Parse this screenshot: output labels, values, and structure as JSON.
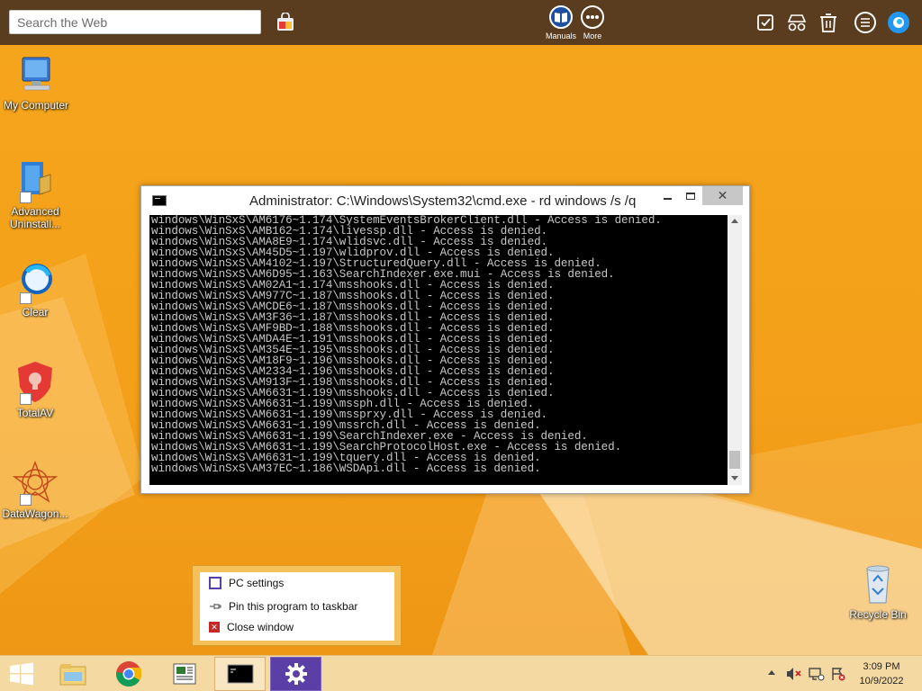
{
  "toolbar": {
    "search_placeholder": "Search the Web",
    "manuals_label": "Manuals",
    "more_label": "More"
  },
  "desktop_icons": [
    {
      "label": "My Computer"
    },
    {
      "label": "Advanced Uninstall..."
    },
    {
      "label": "Clear"
    },
    {
      "label": "TotalAV"
    },
    {
      "label": "DataWagon..."
    },
    {
      "label": "Recycle Bin"
    }
  ],
  "cmd": {
    "title": "Administrator: C:\\Windows\\System32\\cmd.exe - rd  windows /s /q",
    "lines": [
      "windows\\WinSxS\\AM6176~1.174\\SystemEventsBrokerClient.dll - Access is denied.",
      "windows\\WinSxS\\AMB162~1.174\\livessp.dll - Access is denied.",
      "windows\\WinSxS\\AMA8E9~1.174\\wlidsvc.dll - Access is denied.",
      "windows\\WinSxS\\AM45D5~1.197\\wlidprov.dll - Access is denied.",
      "windows\\WinSxS\\AM4102~1.197\\StructuredQuery.dll - Access is denied.",
      "windows\\WinSxS\\AM6D95~1.163\\SearchIndexer.exe.mui - Access is denied.",
      "windows\\WinSxS\\AM02A1~1.174\\msshooks.dll - Access is denied.",
      "windows\\WinSxS\\AM977C~1.187\\msshooks.dll - Access is denied.",
      "windows\\WinSxS\\AMCDE6~1.187\\msshooks.dll - Access is denied.",
      "windows\\WinSxS\\AM3F36~1.187\\msshooks.dll - Access is denied.",
      "windows\\WinSxS\\AMF9BD~1.188\\msshooks.dll - Access is denied.",
      "windows\\WinSxS\\AMDA4E~1.191\\msshooks.dll - Access is denied.",
      "windows\\WinSxS\\AM354E~1.195\\msshooks.dll - Access is denied.",
      "windows\\WinSxS\\AM18F9~1.196\\msshooks.dll - Access is denied.",
      "windows\\WinSxS\\AM2334~1.196\\msshooks.dll - Access is denied.",
      "windows\\WinSxS\\AM913F~1.198\\msshooks.dll - Access is denied.",
      "windows\\WinSxS\\AM6631~1.199\\msshooks.dll - Access is denied.",
      "windows\\WinSxS\\AM6631~1.199\\mssph.dll - Access is denied.",
      "windows\\WinSxS\\AM6631~1.199\\mssprxy.dll - Access is denied.",
      "windows\\WinSxS\\AM6631~1.199\\mssrch.dll - Access is denied.",
      "windows\\WinSxS\\AM6631~1.199\\SearchIndexer.exe - Access is denied.",
      "windows\\WinSxS\\AM6631~1.199\\SearchProtocolHost.exe - Access is denied.",
      "windows\\WinSxS\\AM6631~1.199\\tquery.dll - Access is denied.",
      "windows\\WinSxS\\AM37EC~1.186\\WSDApi.dll - Access is denied."
    ]
  },
  "jumplist": {
    "items": [
      {
        "label": "PC settings"
      },
      {
        "label": "Pin this program to taskbar"
      },
      {
        "label": "Close window"
      }
    ]
  },
  "clock": {
    "time": "3:09 PM",
    "date": "10/9/2022"
  },
  "colors": {
    "wallpaper": "#f4a01a",
    "toolbar": "#5a3d1e",
    "taskbar": "#f5d9a2",
    "active_task": "#5b3ea6"
  }
}
